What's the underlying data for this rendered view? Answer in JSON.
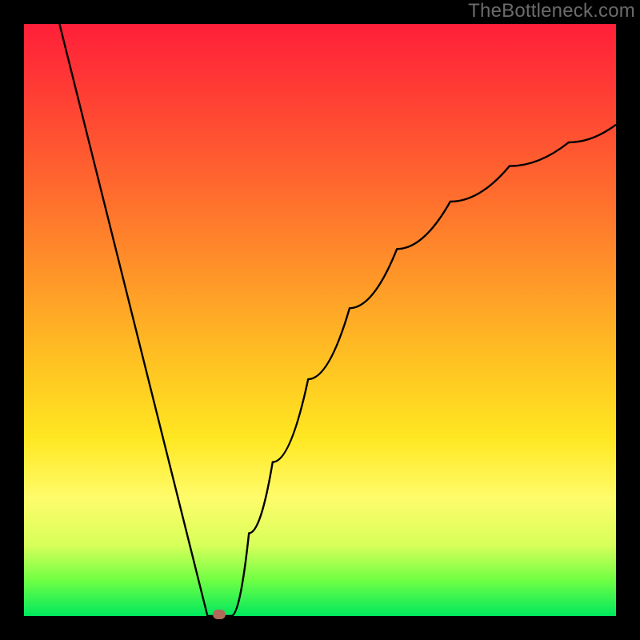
{
  "watermark": "TheBottleneck.com",
  "chart_data": {
    "type": "line",
    "title": "",
    "xlabel": "",
    "ylabel": "",
    "xlim": [
      0,
      100
    ],
    "ylim": [
      0,
      100
    ],
    "cusp": {
      "x": 33,
      "y": 0
    },
    "left_branch": {
      "x_start": 6,
      "y_start": 100,
      "x_end": 31,
      "y_end": 0
    },
    "right_branch_points": [
      {
        "x": 35,
        "y": 0
      },
      {
        "x": 38,
        "y": 14
      },
      {
        "x": 42,
        "y": 26
      },
      {
        "x": 48,
        "y": 40
      },
      {
        "x": 55,
        "y": 52
      },
      {
        "x": 63,
        "y": 62
      },
      {
        "x": 72,
        "y": 70
      },
      {
        "x": 82,
        "y": 76
      },
      {
        "x": 92,
        "y": 80
      },
      {
        "x": 100,
        "y": 83
      }
    ],
    "background_gradient": {
      "top": "#ff1f39",
      "mid": "#ffe722",
      "bottom": "#00e85e"
    }
  }
}
